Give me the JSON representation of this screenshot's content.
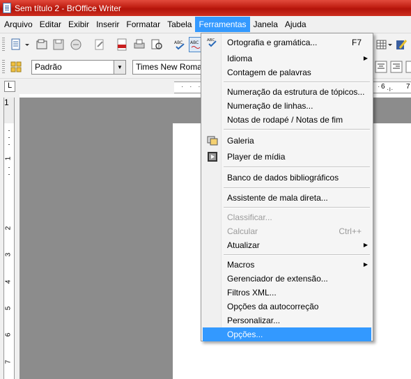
{
  "window": {
    "title": "Sem título 2 - BrOffice Writer"
  },
  "menubar": {
    "items": [
      "Arquivo",
      "Editar",
      "Exibir",
      "Inserir",
      "Formatar",
      "Tabela",
      "Ferramentas",
      "Janela",
      "Ajuda"
    ],
    "active": "Ferramentas"
  },
  "toolbar": {
    "style_value": "Padrão",
    "font_value": "Times New Roma"
  },
  "ruler": {
    "h_labels": [
      "6",
      "7"
    ],
    "v_labels": [
      "1",
      "1",
      "2",
      "3",
      "4",
      "5",
      "6",
      "7"
    ]
  },
  "tools_menu": {
    "items": [
      {
        "label": "Ortografia e gramática...",
        "shortcut": "F7",
        "icon": "spellcheck-icon"
      },
      {
        "label": "Idioma",
        "submenu": true
      },
      {
        "label": "Contagem de palavras"
      },
      {
        "label": "Numeração da estrutura de tópicos..."
      },
      {
        "label": "Numeração de linhas..."
      },
      {
        "label": "Notas de rodapé / Notas de fim"
      },
      {
        "label": "Galeria",
        "icon": "gallery-icon"
      },
      {
        "label": "Player de mídia",
        "icon": "media-player-icon"
      },
      {
        "label": "Banco de dados bibliográficos"
      },
      {
        "label": "Assistente de mala direta..."
      },
      {
        "label": "Classificar...",
        "disabled": true
      },
      {
        "label": "Calcular",
        "shortcut": "Ctrl++",
        "disabled": true
      },
      {
        "label": "Atualizar",
        "submenu": true
      },
      {
        "label": "Macros",
        "submenu": true
      },
      {
        "label": "Gerenciador de extensão..."
      },
      {
        "label": "Filtros XML..."
      },
      {
        "label": "Opções da autocorreção"
      },
      {
        "label": "Personalizar..."
      },
      {
        "label": "Opções...",
        "highlighted": true
      }
    ]
  },
  "colors": {
    "title_bar": "#c01f12",
    "menu_highlight": "#3399ff",
    "workspace": "#8c8c8c"
  }
}
